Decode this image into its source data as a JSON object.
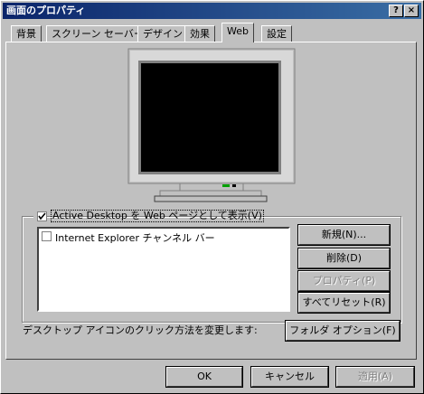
{
  "window": {
    "title": "画面のプロパティ",
    "help_btn": "?",
    "close_btn": "×"
  },
  "tabs": [
    "背景",
    "スクリーン セーバー",
    "デザイン",
    "効果",
    "Web",
    "設定"
  ],
  "active_tab": "Web",
  "active_desktop": {
    "checked": true,
    "label": "Active Desktop を Web ページとして表示(V)"
  },
  "list_items": [
    {
      "checked": false,
      "label": "Internet Explorer チャンネル バー"
    }
  ],
  "side_buttons": {
    "new": "新規(N)...",
    "delete": "削除(D)",
    "properties": "プロパティ(P)",
    "reset": "すべてリセット(R)"
  },
  "desc_text": "デスクトップ アイコンのクリック方法を変更します:",
  "folder_options": "フォルダ オプション(F)",
  "dialog_buttons": {
    "ok": "OK",
    "cancel": "キャンセル",
    "apply": "適用(A)"
  }
}
